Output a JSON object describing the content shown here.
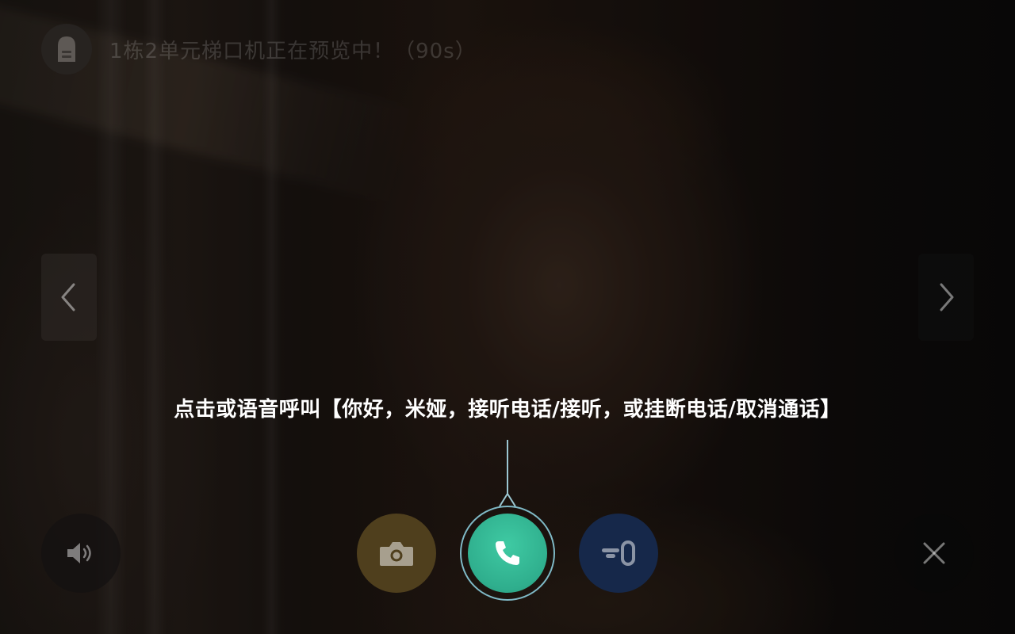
{
  "status": {
    "preview_text": "1栋2单元梯口机正在预览中！（90s）",
    "device_icon": "door-panel-icon"
  },
  "navigation": {
    "prev_icon": "chevron-left-icon",
    "next_icon": "chevron-right-icon"
  },
  "hint": {
    "text": "点击或语音呼叫【你好，米娅，接听电话/接听，或挂断电话/取消通话】"
  },
  "controls": {
    "volume_icon": "speaker-icon",
    "snapshot_icon": "camera-icon",
    "answer_icon": "phone-icon",
    "unlock_icon": "key-icon",
    "close_icon": "close-icon"
  },
  "colors": {
    "answer": "#2fae8d",
    "answer_ring": "#7fb9c6",
    "snapshot": "#4f3f1d",
    "unlock": "#16284a",
    "hint_text": "#ffffff"
  }
}
